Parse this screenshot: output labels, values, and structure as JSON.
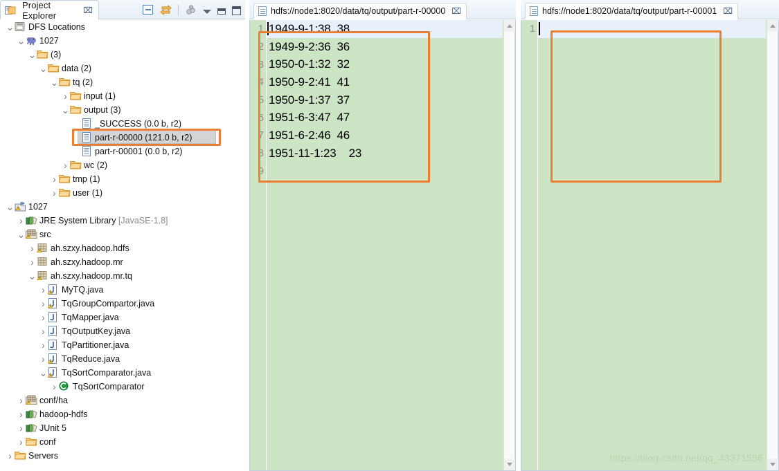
{
  "explorer": {
    "tab_title": "Project Explorer",
    "close_glyph": "⌧",
    "toolbar": [
      {
        "name": "collapse-all-icon",
        "tip": "Collapse All"
      },
      {
        "name": "link-with-editor-icon",
        "tip": "Link with Editor"
      },
      {
        "name": "focus-on-active-task-icon",
        "tip": "Focus on Active Task"
      },
      {
        "name": "view-menu-icon",
        "tip": "View Menu"
      },
      {
        "name": "minimize-icon",
        "tip": "Minimize"
      },
      {
        "name": "maximize-icon",
        "tip": "Maximize"
      }
    ],
    "tree": [
      {
        "label": "DFS Locations",
        "indent": 0,
        "twist": "expanded",
        "icon": "dfs-locations-icon"
      },
      {
        "label": "1027",
        "indent": 1,
        "twist": "expanded",
        "icon": "hadoop-elephant-icon"
      },
      {
        "label": "(3)",
        "indent": 2,
        "twist": "expanded",
        "icon": "folder-icon"
      },
      {
        "label": "data (2)",
        "indent": 3,
        "twist": "expanded",
        "icon": "folder-icon"
      },
      {
        "label": "tq (2)",
        "indent": 4,
        "twist": "expanded",
        "icon": "folder-icon"
      },
      {
        "label": "input (1)",
        "indent": 5,
        "twist": "collapsed",
        "icon": "folder-icon"
      },
      {
        "label": "output (3)",
        "indent": 5,
        "twist": "expanded",
        "icon": "folder-icon"
      },
      {
        "label": "_SUCCESS (0.0 b, r2)",
        "indent": 6,
        "twist": "none",
        "icon": "hdfs-file-icon"
      },
      {
        "label": "part-r-00000 (121.0 b, r2)",
        "indent": 6,
        "twist": "none",
        "icon": "hdfs-file-icon",
        "selected": true,
        "highlighted": true
      },
      {
        "label": "part-r-00001 (0.0 b, r2)",
        "indent": 6,
        "twist": "none",
        "icon": "hdfs-file-icon"
      },
      {
        "label": "wc (2)",
        "indent": 5,
        "twist": "collapsed",
        "icon": "folder-icon"
      },
      {
        "label": "tmp (1)",
        "indent": 4,
        "twist": "collapsed",
        "icon": "folder-icon"
      },
      {
        "label": "user (1)",
        "indent": 4,
        "twist": "collapsed",
        "icon": "folder-icon"
      },
      {
        "label": "1027",
        "indent": 0,
        "twist": "expanded",
        "icon": "java-project-icon"
      },
      {
        "label": "JRE System Library",
        "suffix": " [JavaSE-1.8]",
        "indent": 1,
        "twist": "collapsed",
        "icon": "jre-library-icon"
      },
      {
        "label": "src",
        "indent": 1,
        "twist": "expanded",
        "icon": "source-folder-icon"
      },
      {
        "label": "ah.szxy.hadoop.hdfs",
        "indent": 2,
        "twist": "collapsed",
        "icon": "package-warning-icon"
      },
      {
        "label": "ah.szxy.hadoop.mr",
        "indent": 2,
        "twist": "collapsed",
        "icon": "package-icon"
      },
      {
        "label": "ah.szxy.hadoop.mr.tq",
        "indent": 2,
        "twist": "expanded",
        "icon": "package-warning-icon"
      },
      {
        "label": "MyTQ.java",
        "indent": 3,
        "twist": "collapsed",
        "icon": "java-file-warning-icon"
      },
      {
        "label": "TqGroupCompartor.java",
        "indent": 3,
        "twist": "collapsed",
        "icon": "java-file-warning-icon"
      },
      {
        "label": "TqMapper.java",
        "indent": 3,
        "twist": "collapsed",
        "icon": "java-file-icon"
      },
      {
        "label": "TqOutputKey.java",
        "indent": 3,
        "twist": "collapsed",
        "icon": "java-file-icon"
      },
      {
        "label": "TqPartitioner.java",
        "indent": 3,
        "twist": "collapsed",
        "icon": "java-file-icon"
      },
      {
        "label": "TqReduce.java",
        "indent": 3,
        "twist": "collapsed",
        "icon": "java-file-warning-icon"
      },
      {
        "label": "TqSortComparator.java",
        "indent": 3,
        "twist": "expanded",
        "icon": "java-file-warning-icon"
      },
      {
        "label": "TqSortComparator",
        "indent": 4,
        "twist": "collapsed",
        "icon": "java-class-icon"
      },
      {
        "label": "conf/ha",
        "indent": 1,
        "twist": "collapsed",
        "icon": "source-folder-icon"
      },
      {
        "label": "hadoop-hdfs",
        "indent": 1,
        "twist": "collapsed",
        "icon": "library-icon"
      },
      {
        "label": "JUnit 5",
        "indent": 1,
        "twist": "collapsed",
        "icon": "library-icon"
      },
      {
        "label": "conf",
        "indent": 1,
        "twist": "collapsed",
        "icon": "folder-icon"
      },
      {
        "label": "Servers",
        "indent": 0,
        "twist": "collapsed",
        "icon": "folder-icon"
      }
    ]
  },
  "editors": [
    {
      "tab_title": "hdfs://node1:8020/data/tq/output/part-r-00000",
      "close_glyph": "⌧",
      "lines": [
        {
          "n": "1",
          "text": "1949-9-1:38  38",
          "current": true
        },
        {
          "n": "2",
          "text": "1949-9-2:36  36"
        },
        {
          "n": "3",
          "text": "1950-0-1:32  32"
        },
        {
          "n": "4",
          "text": "1950-9-2:41  41"
        },
        {
          "n": "5",
          "text": "1950-9-1:37  37"
        },
        {
          "n": "6",
          "text": "1951-6-3:47  47"
        },
        {
          "n": "7",
          "text": "1951-6-2:46  46"
        },
        {
          "n": "8",
          "text": "1951-11-1:23    23"
        },
        {
          "n": "9",
          "text": ""
        }
      ]
    },
    {
      "tab_title": "hdfs://node1:8020/data/tq/output/part-r-00001",
      "close_glyph": "⌧",
      "lines": [
        {
          "n": "1",
          "text": "",
          "current": true
        }
      ]
    }
  ],
  "watermark": "https://blog.csdn.net/qq_43371556",
  "colors": {
    "highlight_box": "#ed7d31",
    "editor_background": "#cde5c5",
    "current_line": "#e8f0fb",
    "selection": "#d4d4d4"
  }
}
